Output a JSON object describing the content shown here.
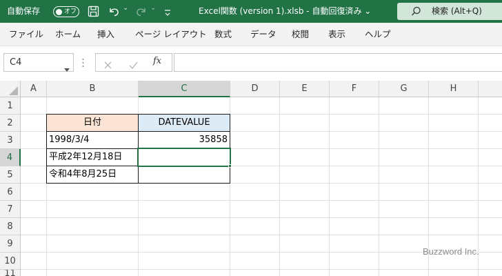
{
  "titlebar": {
    "autosave_label": "自動保存",
    "autosave_state": "オフ",
    "doc_title": "Excel関数 (version 1).xlsb - 自動回復済み ⌄",
    "search_placeholder": "検索 (Alt+Q)",
    "colors": {
      "bar": "#217346",
      "search": "#d1e5d9"
    }
  },
  "ribbon": {
    "tabs": [
      "ファイル",
      "ホーム",
      "挿入",
      "ページ レイアウト",
      "数式",
      "データ",
      "校閲",
      "表示",
      "ヘルプ"
    ]
  },
  "formula_bar": {
    "name_box": "C4",
    "formula": ""
  },
  "grid": {
    "columns": [
      "A",
      "B",
      "C",
      "D",
      "E",
      "F",
      "G",
      "H"
    ],
    "rows": [
      "1",
      "2",
      "3",
      "4",
      "5",
      "6",
      "7",
      "8",
      "9",
      "10",
      "11"
    ],
    "selected_cell": "C4",
    "header_left": "日付",
    "header_right": "DATEVALUE",
    "b3": "1998/3/4",
    "c3": "35858",
    "b4": "平成2年12月18日",
    "b5": "令和4年8月25日"
  },
  "watermark": "Buzzword Inc."
}
